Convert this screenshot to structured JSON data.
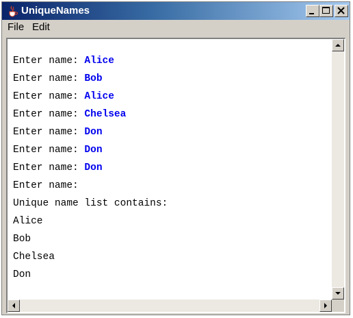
{
  "window": {
    "title": "UniqueNames",
    "icon": "java-cup-icon"
  },
  "titlebar_buttons": [
    "minimize-icon",
    "maximize-icon",
    "close-icon"
  ],
  "menu": [
    "File",
    "Edit"
  ],
  "console": {
    "prompt": "Enter name: ",
    "inputs": [
      "Alice",
      "Bob",
      "Alice",
      "Chelsea",
      "Don",
      "Don",
      "Don"
    ],
    "empty_prompt": "Enter name:",
    "summary": "Unique name list contains:",
    "unique_names": [
      "Alice",
      "Bob",
      "Chelsea",
      "Don"
    ]
  },
  "colors": {
    "input_text": "#0000ee",
    "titlebar_start": "#0a246a",
    "titlebar_end": "#a6caf0"
  }
}
